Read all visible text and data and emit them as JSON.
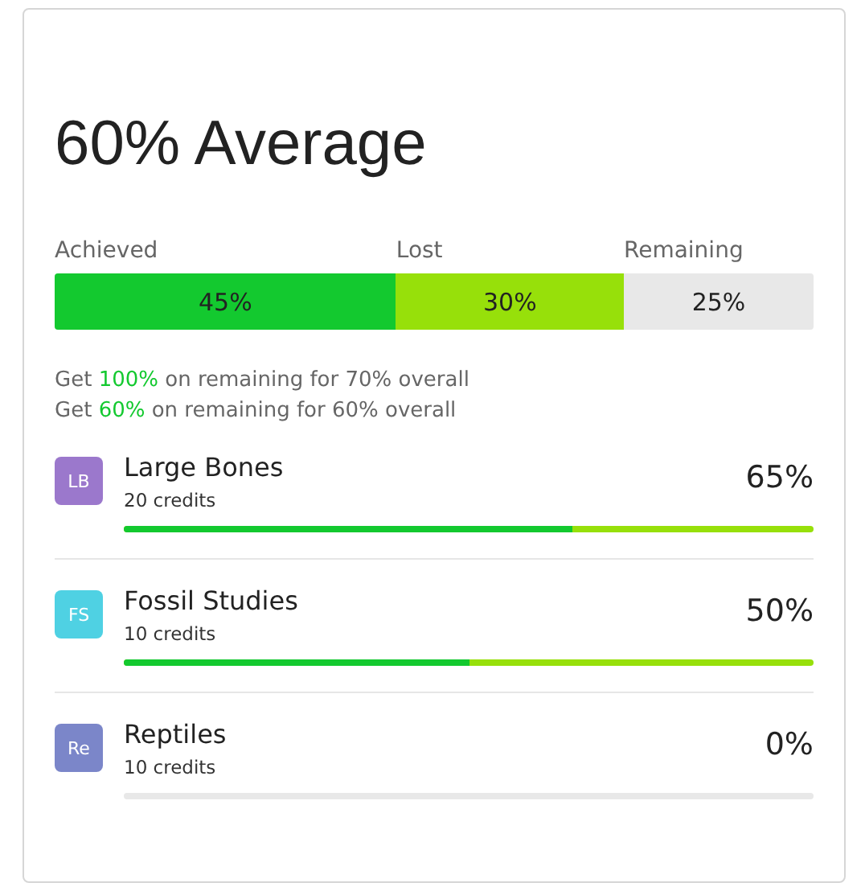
{
  "title": "60% Average",
  "breakdown": [
    {
      "label": "Achieved",
      "value": "45%",
      "color": "#13c92f"
    },
    {
      "label": "Lost",
      "value": "30%",
      "color": "#97e00a"
    },
    {
      "label": "Remaining",
      "value": "25%",
      "color": "#e8e8e8"
    }
  ],
  "scenarios": [
    {
      "before": "Get ",
      "highlight": "100%",
      "after": " on remaining for 70% overall"
    },
    {
      "before": "Get ",
      "highlight": "60%",
      "after": " on remaining for 60% overall"
    }
  ],
  "courses": [
    {
      "initials": "LB",
      "color": "#9b78cc",
      "name": "Large Bones",
      "credits": "20 credits",
      "percent": "65%",
      "level": 0.65,
      "started": true
    },
    {
      "initials": "FS",
      "color": "#4fd1e3",
      "name": "Fossil Studies",
      "credits": "10 credits",
      "percent": "50%",
      "level": 0.5,
      "started": true
    },
    {
      "initials": "Re",
      "color": "#7b86c9",
      "name": "Reptiles",
      "credits": "10 credits",
      "percent": "0%",
      "level": 0,
      "started": false
    }
  ]
}
